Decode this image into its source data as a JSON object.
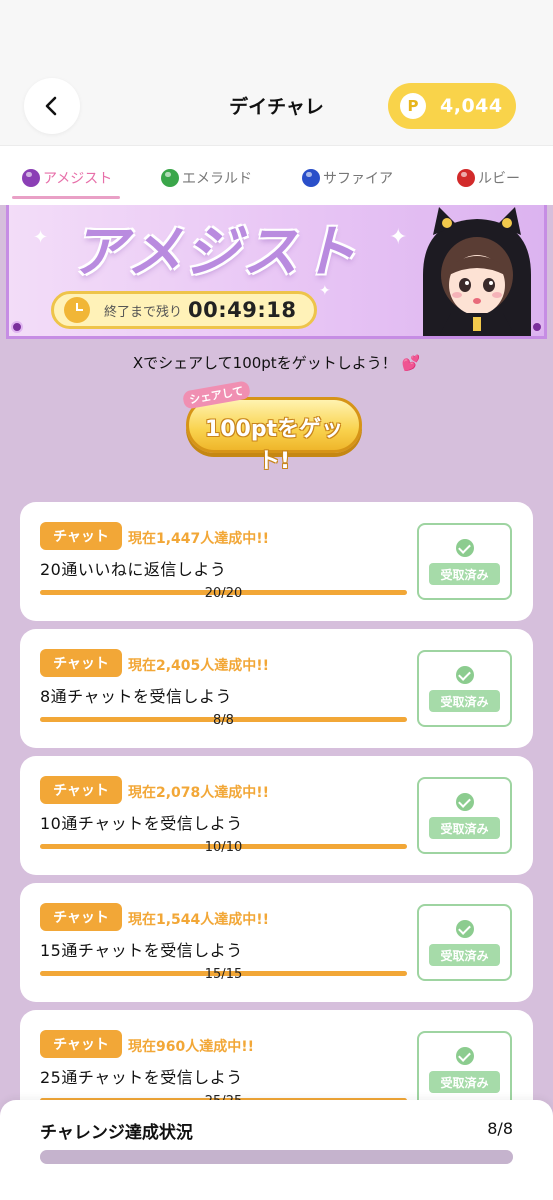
{
  "header": {
    "title": "デイチャレ",
    "points": "4,044",
    "coin_letter": "P",
    "back_icon": "chevron-left-icon"
  },
  "tabs": [
    {
      "label": "アメジスト",
      "gem_color": "#8b3fb5",
      "active": true
    },
    {
      "label": "エメラルド",
      "gem_color": "#3aa64a",
      "active": false
    },
    {
      "label": "サファイア",
      "gem_color": "#2a4fc9",
      "active": false
    },
    {
      "label": "ルビー",
      "gem_color": "#d22a2a",
      "active": false
    }
  ],
  "banner": {
    "title": "アメジスト",
    "timer_label": "終了まで残り",
    "timer_value": "00:49:18",
    "clock_icon": "clock-icon"
  },
  "share": {
    "text": "Xでシェアして100ptをゲットしよう！",
    "heart": "💕",
    "button_small": "シェアして",
    "button_main": "100ptをゲット!"
  },
  "missions": [
    {
      "category": "チャット",
      "achieved": "現在1,447人達成中!!",
      "title": "20通いいねに返信しよう",
      "progress": "20/20",
      "progress_ratio": 1.0,
      "claim_label": "受取済み"
    },
    {
      "category": "チャット",
      "achieved": "現在2,405人達成中!!",
      "title": "8通チャットを受信しよう",
      "progress": "8/8",
      "progress_ratio": 1.0,
      "claim_label": "受取済み"
    },
    {
      "category": "チャット",
      "achieved": "現在2,078人達成中!!",
      "title": "10通チャットを受信しよう",
      "progress": "10/10",
      "progress_ratio": 1.0,
      "claim_label": "受取済み"
    },
    {
      "category": "チャット",
      "achieved": "現在1,544人達成中!!",
      "title": "15通チャットを受信しよう",
      "progress": "15/15",
      "progress_ratio": 1.0,
      "claim_label": "受取済み"
    },
    {
      "category": "チャット",
      "achieved": "現在960人達成中!!",
      "title": "25通チャットを受信しよう",
      "progress": "25/25",
      "progress_ratio": 1.0,
      "claim_label": "受取済み"
    }
  ],
  "status": {
    "title": "チャレンジ達成状況",
    "count": "8/8",
    "progress_ratio": 1.0
  },
  "colors": {
    "accent_orange": "#f2a737",
    "claimed_green": "#8ccc8f",
    "points_yellow": "#f9d34a",
    "tab_active_pink": "#e76fa9",
    "background_lavender": "#d6bfdc"
  }
}
